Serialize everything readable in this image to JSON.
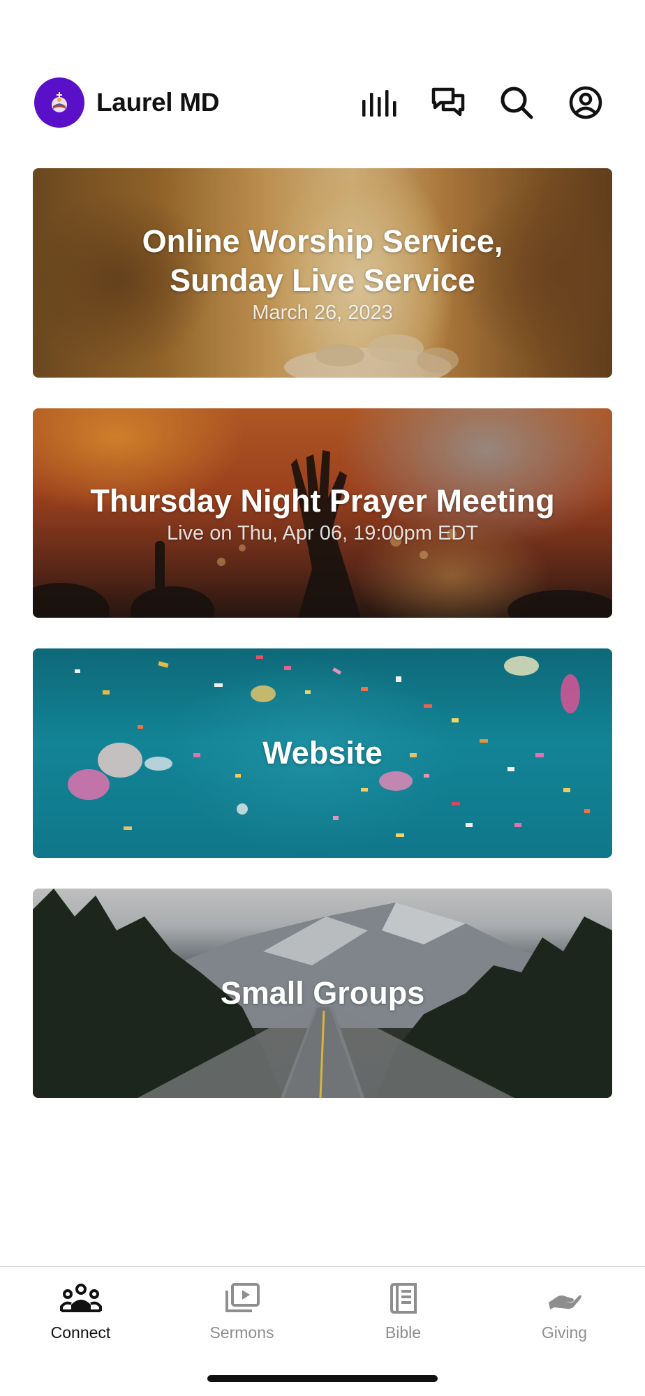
{
  "header": {
    "title": "Laurel MD",
    "icons": [
      "audio-bars-icon",
      "chat-bubbles-icon",
      "search-icon",
      "profile-icon"
    ]
  },
  "cards": [
    {
      "title_line1": "Online Worship Service,",
      "title_line2": "Sunday Live Service",
      "subtitle": "March 26, 2023"
    },
    {
      "title": "Thursday Night Prayer Meeting",
      "subtitle": "Live on Thu, Apr 06, 19:00pm EDT"
    },
    {
      "title": "Website"
    },
    {
      "title": "Small Groups"
    }
  ],
  "tabbar": {
    "tabs": [
      {
        "label": "Connect",
        "icon": "people-icon",
        "active": true
      },
      {
        "label": "Sermons",
        "icon": "video-stack-icon",
        "active": false
      },
      {
        "label": "Bible",
        "icon": "book-icon",
        "active": false
      },
      {
        "label": "Giving",
        "icon": "giving-hand-icon",
        "active": false
      }
    ]
  },
  "colors": {
    "brand": "#5a10c8",
    "active_tab": "#111111",
    "inactive_tab": "#8e8e8e"
  }
}
